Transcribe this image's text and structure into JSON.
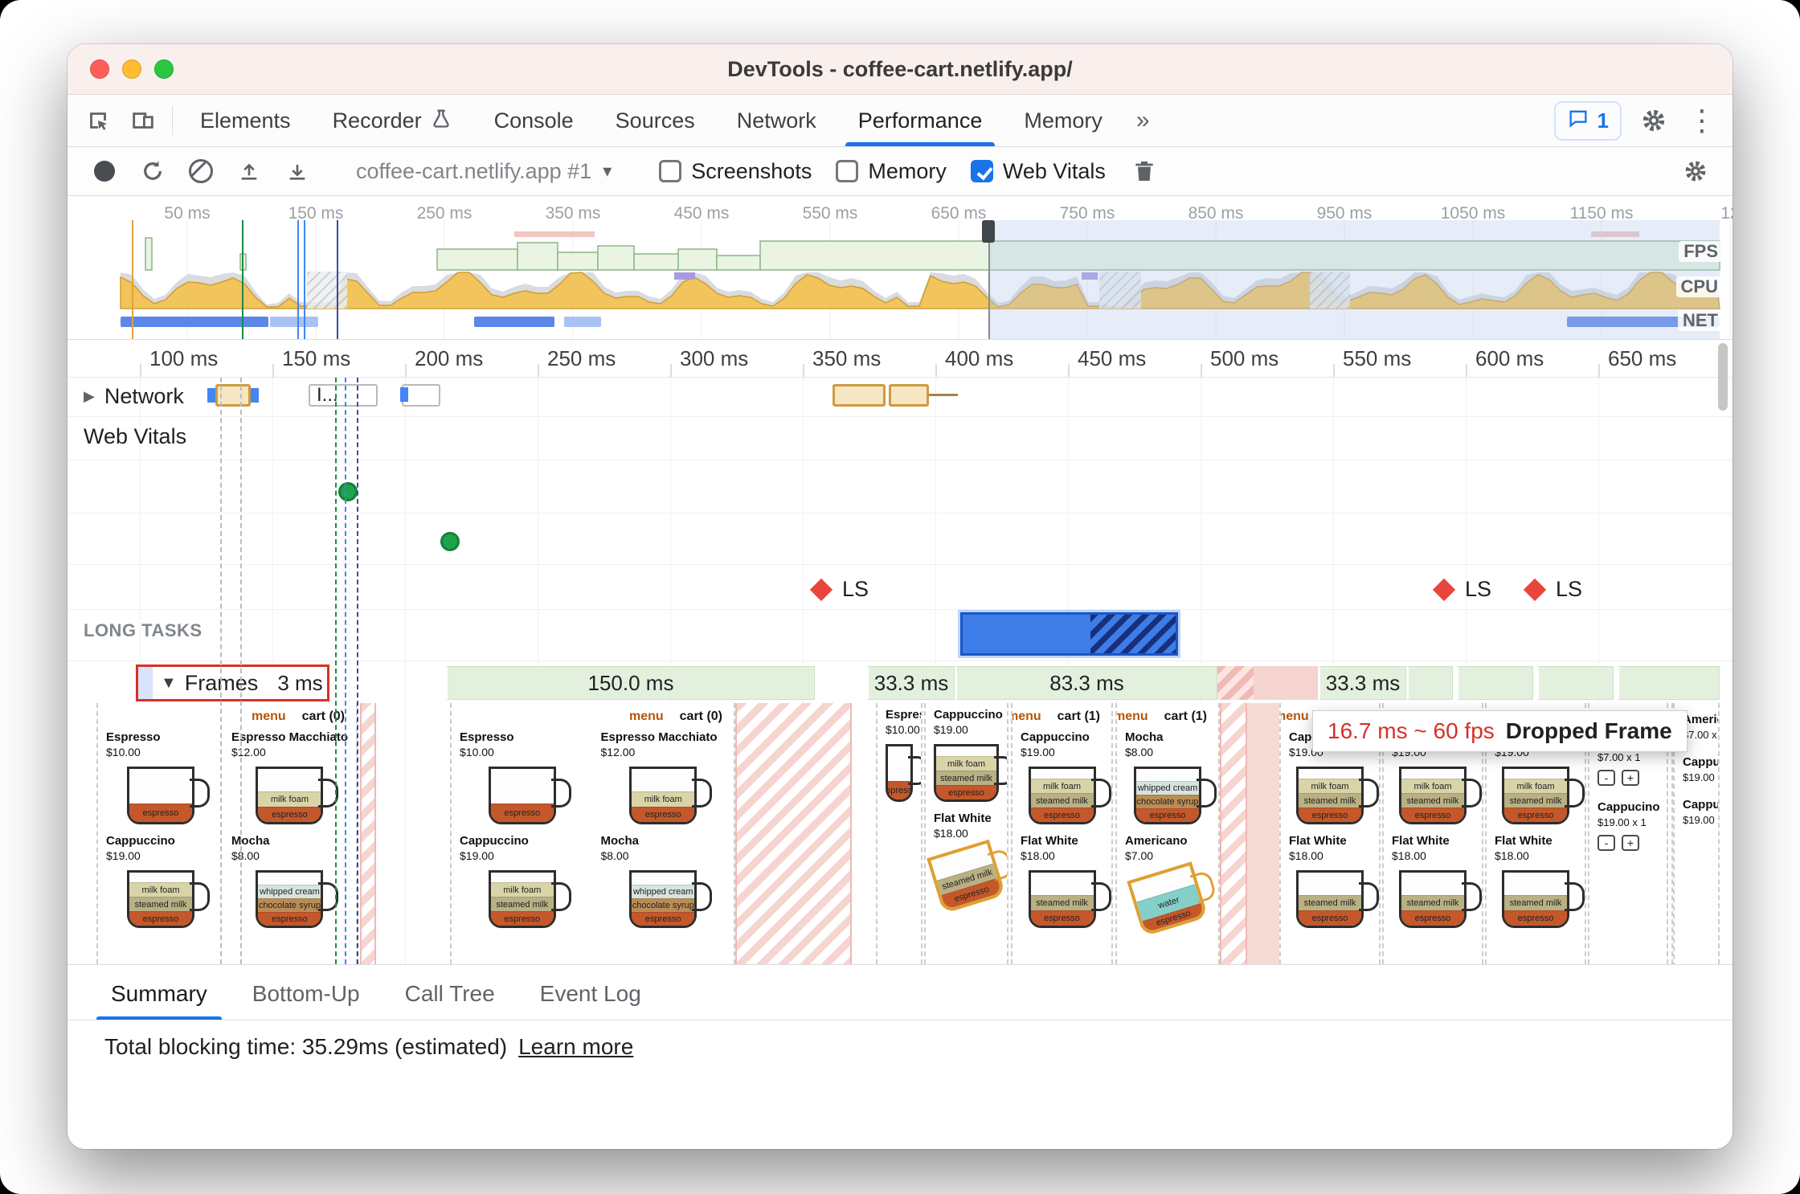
{
  "colors": {
    "accent": "#1a73e8",
    "selection_red": "#d93025",
    "fps_green": "#8cb585",
    "cpu_yellow": "#f2c45c",
    "net_blue": "#5a87e8",
    "vitals_green": "#1fa24c",
    "layout_shift_red": "#e8453c",
    "long_task_blue": "#3e7de8",
    "frame_green": "#e4f0de",
    "dropped_pink": "#f5d4d0"
  },
  "titlebar": {
    "title": "DevTools - coffee-cart.netlify.app/"
  },
  "tabbar": {
    "tabs": [
      {
        "label": "Elements"
      },
      {
        "label": "Recorder",
        "icon": "beaker-icon"
      },
      {
        "label": "Console"
      },
      {
        "label": "Sources"
      },
      {
        "label": "Network"
      },
      {
        "label": "Performance",
        "active": true
      },
      {
        "label": "Memory"
      }
    ],
    "overflow": "»",
    "issues_count": "1"
  },
  "toolbar": {
    "profile": "coffee-cart.netlify.app #1",
    "checkboxes": [
      {
        "label": "Screenshots",
        "checked": false
      },
      {
        "label": "Memory",
        "checked": false
      },
      {
        "label": "Web Vitals",
        "checked": true
      }
    ]
  },
  "overview": {
    "time_labels": [
      "50 ms",
      "150 ms",
      "250 ms",
      "350 ms",
      "450 ms",
      "550 ms",
      "650 ms",
      "750 ms",
      "850 ms",
      "950 ms",
      "1050 ms",
      "1150 ms",
      "12"
    ],
    "lanes": [
      "FPS",
      "CPU",
      "NET"
    ]
  },
  "ruler_labels": [
    "100 ms",
    "150 ms",
    "200 ms",
    "250 ms",
    "300 ms",
    "350 ms",
    "400 ms",
    "450 ms",
    "500 ms",
    "550 ms",
    "600 ms",
    "650 ms"
  ],
  "network": {
    "label": "Network",
    "truncated_request": "I..."
  },
  "web_vitals": {
    "label": "Web Vitals",
    "marker": "LS"
  },
  "long_tasks": {
    "label": "LONG TASKS"
  },
  "frames": {
    "label": "Frames",
    "selected_duration": "3 ms",
    "durations": [
      "150.0 ms",
      "33.3 ms",
      "83.3 ms",
      "33.3 ms"
    ]
  },
  "tooltip": {
    "timing": "16.7 ms ~ 60 fps",
    "label": "Dropped Frame"
  },
  "icons": {
    "collapsed_arrow": "▶",
    "expanded_arrow": "▼",
    "dropdown_caret": "▾",
    "kebab_menu": "⋮"
  },
  "filmstrip": {
    "app_header": {
      "menu": "menu",
      "cart0": "cart (0)",
      "cart1": "cart (1)"
    },
    "products": {
      "espresso": {
        "name": "Espresso",
        "price": "$10.00",
        "layers": [
          [
            "espresso",
            "esp",
            22
          ]
        ]
      },
      "macchiato": {
        "name": "Espresso Macchiato",
        "price": "$12.00",
        "layers": [
          [
            "milk foam",
            "foam",
            18
          ],
          [
            "espresso",
            "esp",
            18
          ]
        ]
      },
      "cappuccino": {
        "name": "Cappuccino",
        "price": "$19.00",
        "layers": [
          [
            "milk foam",
            "foam",
            17
          ],
          [
            "steamed milk",
            "steamed",
            17
          ],
          [
            "espresso",
            "esp",
            17
          ]
        ]
      },
      "mocha": {
        "name": "Mocha",
        "price": "$8.00",
        "layers": [
          [
            "whipped cream",
            "whip",
            16
          ],
          [
            "chocolate syrup",
            "choc",
            16
          ],
          [
            "espresso",
            "esp",
            16
          ]
        ]
      },
      "flatwhite": {
        "name": "Flat White",
        "price": "$18.00",
        "layers": [
          [
            "steamed milk",
            "steamed",
            18
          ],
          [
            "espresso",
            "esp",
            18
          ]
        ]
      },
      "americano": {
        "name": "Americano",
        "price": "$7.00",
        "layers": [
          [
            "water",
            "water",
            24
          ],
          [
            "espresso",
            "esp",
            14
          ]
        ]
      }
    },
    "cart_page": {
      "rows": [
        {
          "name": "Americano",
          "detail": "$7.00 x 1"
        },
        {
          "name": "Cappucino",
          "detail": "$19.00 x 1"
        }
      ],
      "partial_rows": [
        {
          "name": "Americ",
          "detail": "$7.00 x"
        },
        {
          "name": "Cappuc",
          "detail": "$19.00"
        },
        {
          "name": "Cappucino",
          "detail": "$19.00 x 1"
        }
      ],
      "stepper_minus": "-",
      "stepper_plus": "+"
    }
  },
  "bottom_tabs": [
    {
      "label": "Summary",
      "active": true
    },
    {
      "label": "Bottom-Up"
    },
    {
      "label": "Call Tree"
    },
    {
      "label": "Event Log"
    }
  ],
  "statusbar": {
    "text": "Total blocking time: 35.29ms (estimated)",
    "link": "Learn more"
  }
}
